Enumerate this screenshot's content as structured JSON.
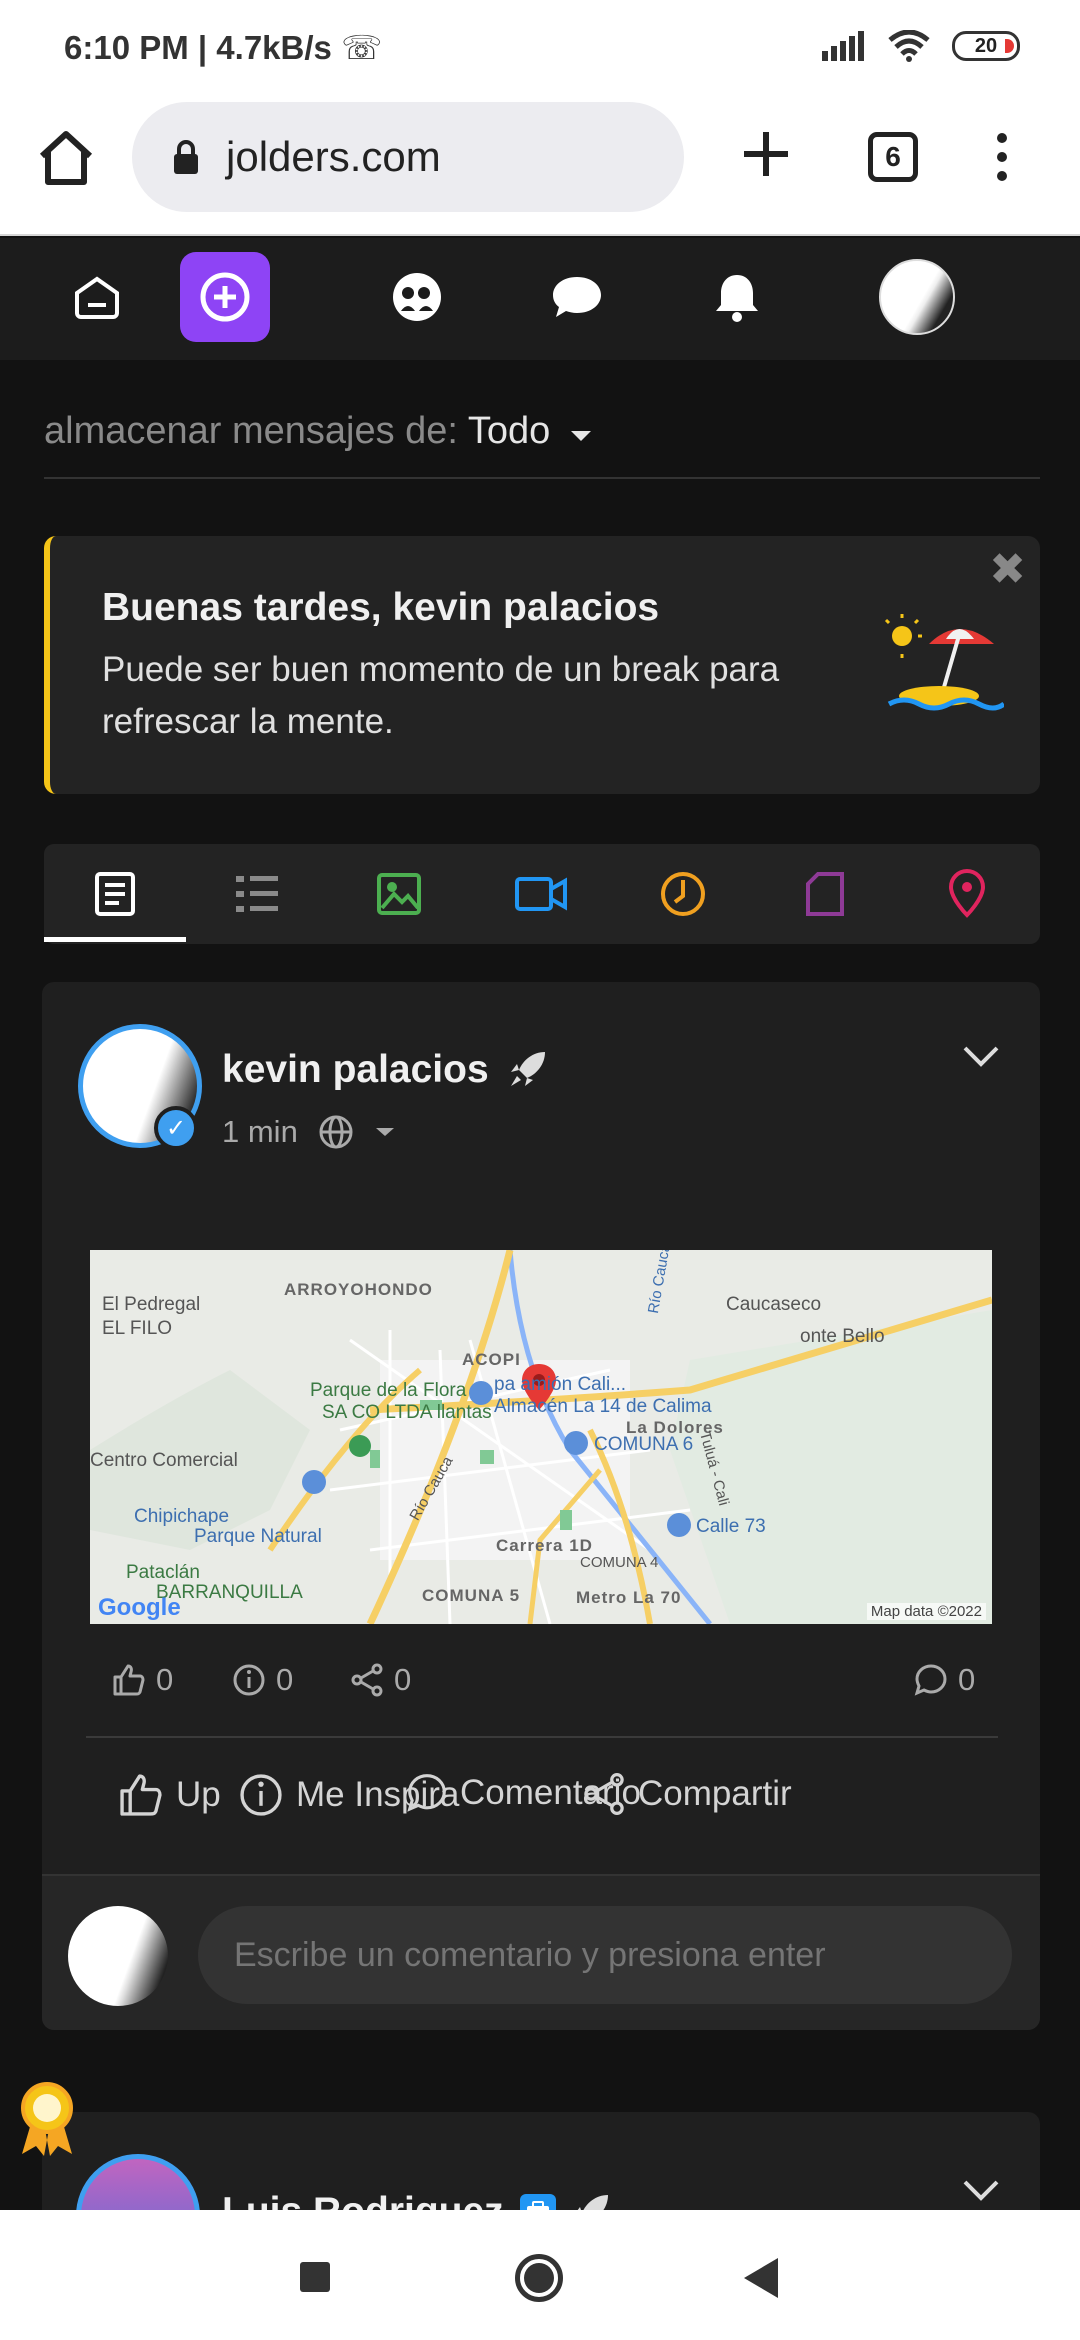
{
  "status_bar": {
    "time": "6:10 PM",
    "speed": "4.7kB/s",
    "battery": "20"
  },
  "browser": {
    "url": "jolders.com",
    "tab_count": "6"
  },
  "filter": {
    "label": "almacenar mensajes de:",
    "value": "Todo"
  },
  "greeting": {
    "title": "Buenas tardes, kevin palacios",
    "message": "Puede ser buen momento de un break para refrescar la mente."
  },
  "post": {
    "author": "kevin palacios",
    "time": "1 min",
    "map": {
      "labels": [
        "El Pedregal",
        "EL FILO",
        "ARROYOHONDO",
        "ACOPI",
        "Parque de la Flora",
        "SA  CO LTDA llantas",
        "pa  amión Cali...",
        "Almacén La 14 de Calima",
        "COMUNA 6",
        "La Dolores",
        "Caucaseco",
        "onte Bello",
        "Centro Comercial",
        "Chipichape",
        "Parque Natural",
        "Pataclán",
        "BARRANQUILLA",
        "Carrera 1D",
        "COMUNA 4",
        "COMUNA 5",
        "Metro La 70",
        "Calle 73",
        "Tuluá - Cali",
        "Río Cauca"
      ],
      "attribution": "Map data ©2022",
      "logo": "Google"
    },
    "stats": {
      "likes": "0",
      "inspires": "0",
      "shares": "0",
      "comments": "0"
    },
    "actions": {
      "up": "Up",
      "inspire": "Me Inspira",
      "comment": "Comentario",
      "share": "Compartir"
    },
    "comment_placeholder": "Escribe un comentario y presiona enter"
  },
  "next_post": {
    "author": "Luis Rodriguez"
  },
  "colors": {
    "accent": "#8e44f5",
    "verified": "#3f9ff0",
    "greeting_border": "#f5c518"
  }
}
